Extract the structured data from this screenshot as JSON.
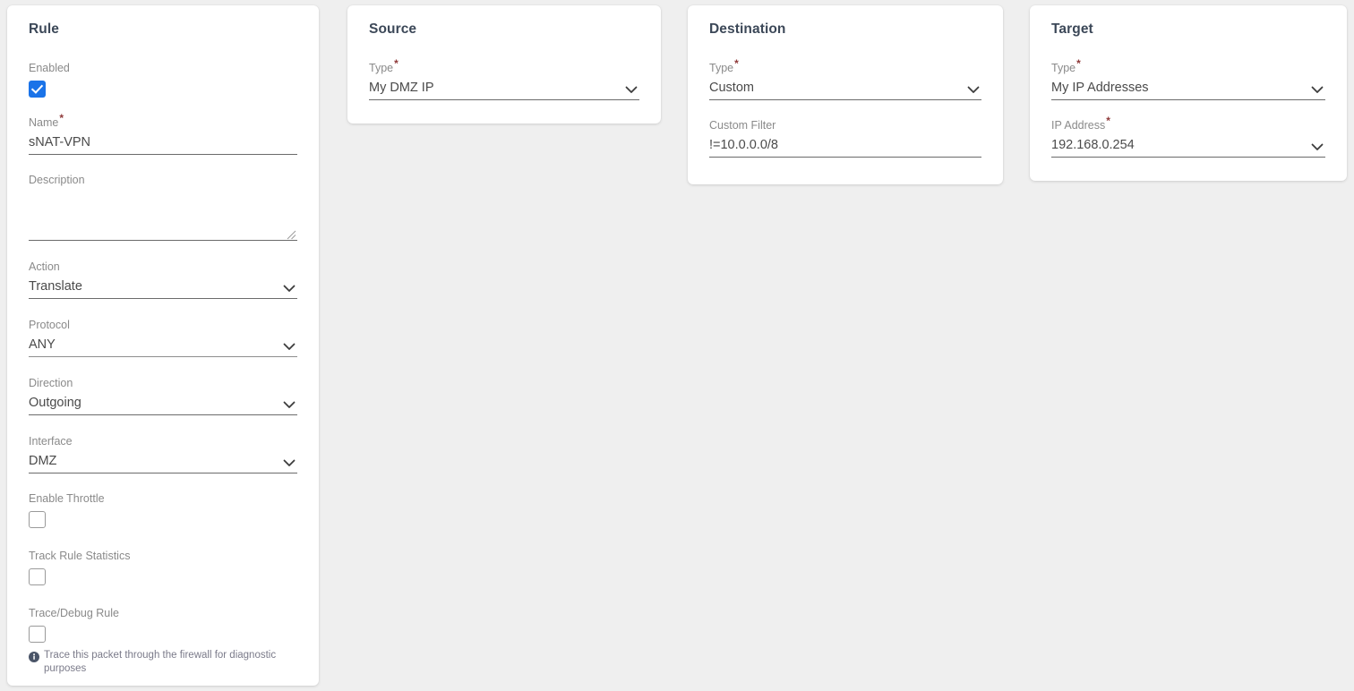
{
  "cards": {
    "rule": {
      "title": "Rule",
      "fields": {
        "enabled": {
          "label": "Enabled",
          "checked": true
        },
        "name": {
          "label": "Name",
          "required": "*",
          "value": "sNAT-VPN"
        },
        "description": {
          "label": "Description",
          "value": ""
        },
        "action": {
          "label": "Action",
          "value": "Translate"
        },
        "protocol": {
          "label": "Protocol",
          "value": "ANY"
        },
        "direction": {
          "label": "Direction",
          "value": "Outgoing"
        },
        "interface": {
          "label": "Interface",
          "value": "DMZ"
        },
        "enable_throttle": {
          "label": "Enable Throttle",
          "checked": false
        },
        "track_rule_statistics": {
          "label": "Track Rule Statistics",
          "checked": false
        },
        "trace_debug_rule": {
          "label": "Trace/Debug Rule",
          "checked": false
        }
      },
      "hint": "Trace this packet through the firewall for diagnostic purposes"
    },
    "source": {
      "title": "Source",
      "fields": {
        "type": {
          "label": "Type",
          "required": "*",
          "value": "My DMZ IP"
        }
      }
    },
    "destination": {
      "title": "Destination",
      "fields": {
        "type": {
          "label": "Type",
          "required": "*",
          "value": "Custom"
        },
        "custom_filter": {
          "label": "Custom Filter",
          "value": "!=10.0.0.0/8"
        }
      }
    },
    "target": {
      "title": "Target",
      "fields": {
        "type": {
          "label": "Type",
          "required": "*",
          "value": "My IP Addresses"
        },
        "ip_address": {
          "label": "IP Address",
          "required": "*",
          "value": "192.168.0.254"
        }
      }
    }
  },
  "colors": {
    "background": "#efefef",
    "card": "#ffffff",
    "accent_checkbox": "#1a73e8",
    "required_asterisk": "#8f3a3a",
    "label": "#8a8a8a",
    "value": "#4a4a4a",
    "title": "#3c4858"
  }
}
